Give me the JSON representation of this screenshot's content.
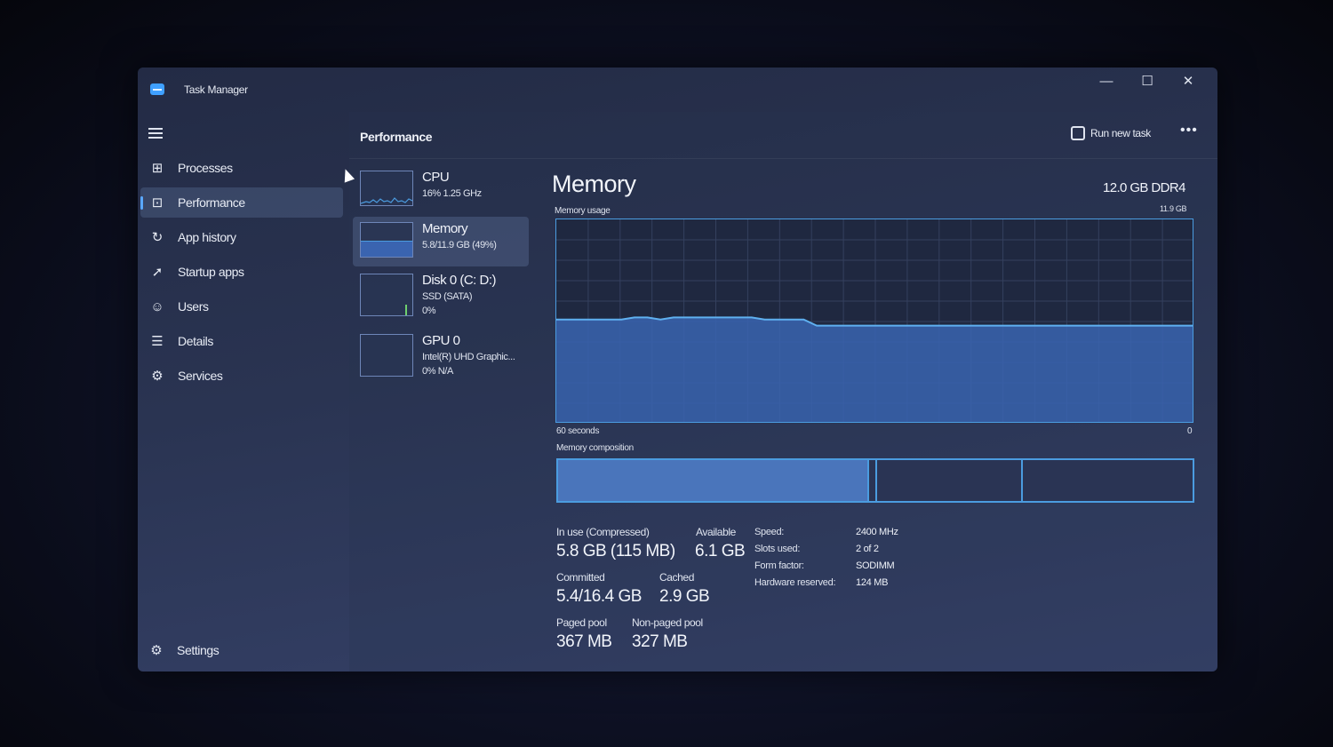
{
  "window": {
    "title": "Task Manager",
    "controls": {
      "minimize": "—",
      "maximize": "☐",
      "close": "✕"
    }
  },
  "sidebar": {
    "items": [
      {
        "label": "Processes",
        "icon": "processes-icon",
        "glyph": "⊞",
        "active": false
      },
      {
        "label": "Performance",
        "icon": "performance-icon",
        "glyph": "⊡",
        "active": true
      },
      {
        "label": "App history",
        "icon": "history-icon",
        "glyph": "↻",
        "active": false
      },
      {
        "label": "Startup apps",
        "icon": "startup-icon",
        "glyph": "➚",
        "active": false
      },
      {
        "label": "Users",
        "icon": "users-icon",
        "glyph": "☺",
        "active": false
      },
      {
        "label": "Details",
        "icon": "details-icon",
        "glyph": "☰",
        "active": false
      },
      {
        "label": "Services",
        "icon": "services-icon",
        "glyph": "⚙",
        "active": false
      }
    ],
    "settings_label": "Settings"
  },
  "header": {
    "title": "Performance",
    "run_task_label": "Run new task",
    "more_label": "•••"
  },
  "devices": [
    {
      "name": "CPU",
      "line1": "16%  1.25 GHz",
      "line2": ""
    },
    {
      "name": "Memory",
      "line1": "5.8/11.9 GB (49%)",
      "line2": ""
    },
    {
      "name": "Disk 0 (C: D:)",
      "line1": "SSD (SATA)",
      "line2": "0%"
    },
    {
      "name": "GPU 0",
      "line1": "Intel(R) UHD Graphic...",
      "line2": "0% N/A"
    }
  ],
  "memory": {
    "title": "Memory",
    "spec": "12.0 GB DDR4",
    "usage_label": "Memory usage",
    "max_label": "11.9 GB",
    "time_label": "60 seconds",
    "zero_label": "0",
    "composition_label": "Memory composition",
    "usage_history_fraction": [
      0.51,
      0.51,
      0.51,
      0.51,
      0.51,
      0.51,
      0.52,
      0.52,
      0.51,
      0.52,
      0.52,
      0.52,
      0.52,
      0.52,
      0.52,
      0.52,
      0.51,
      0.51,
      0.51,
      0.51,
      0.48,
      0.48,
      0.48,
      0.48,
      0.48,
      0.48,
      0.48,
      0.48,
      0.48,
      0.48,
      0.48,
      0.48,
      0.48,
      0.48,
      0.48,
      0.48,
      0.48,
      0.48,
      0.48,
      0.48,
      0.48,
      0.48,
      0.48,
      0.48,
      0.48,
      0.48,
      0.48,
      0.48,
      0.48,
      0.48
    ],
    "composition_fractions": {
      "in_use": 0.488,
      "modified": 0.012,
      "standby": 0.23,
      "free": 0.27
    },
    "stats": {
      "in_use_label": "In use (Compressed)",
      "in_use_value": "5.8 GB (115 MB)",
      "available_label": "Available",
      "available_value": "6.1 GB",
      "committed_label": "Committed",
      "committed_value": "5.4/16.4 GB",
      "cached_label": "Cached",
      "cached_value": "2.9 GB",
      "paged_label": "Paged pool",
      "paged_value": "367 MB",
      "nonpaged_label": "Non-paged pool",
      "nonpaged_value": "327 MB"
    },
    "specs": [
      {
        "label": "Speed:",
        "value": "2400 MHz"
      },
      {
        "label": "Slots used:",
        "value": "2 of 2"
      },
      {
        "label": "Form factor:",
        "value": "SODIMM"
      },
      {
        "label": "Hardware reserved:",
        "value": "124 MB"
      }
    ]
  },
  "colors": {
    "accent": "#4b9ce0",
    "fill": "#3a64b0",
    "active_indicator": "#5aa8ff"
  }
}
